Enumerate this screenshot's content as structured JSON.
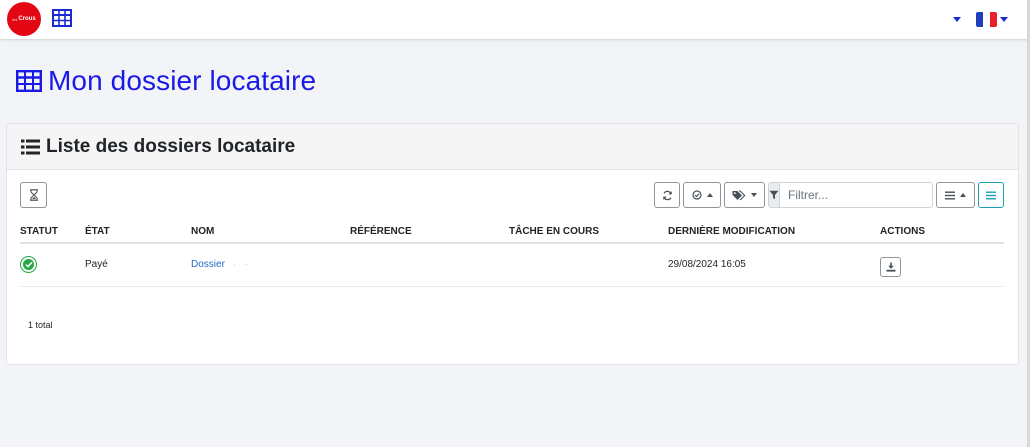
{
  "navbar": {
    "logo_small": "les",
    "logo_text": "Crous",
    "table_icon": "table-icon",
    "user_menu_caret": "caret-down-icon",
    "language_flag": "flag-fr-icon",
    "colors": {
      "accent": "#1a1ae6",
      "logo_bg": "#e30613"
    }
  },
  "page": {
    "title": "Mon dossier locataire",
    "title_icon": "table-icon"
  },
  "card": {
    "title": "Liste des dossiers locataire",
    "title_icon": "list-icon"
  },
  "toolbar": {
    "pending_icon": "hourglass-icon",
    "refresh_icon": "refresh-icon",
    "status_filter_icon": "check-circle-icon",
    "tags_icon": "tags-icon",
    "filter_icon": "filter-icon",
    "filter_placeholder": "Filtrer...",
    "columns_icon": "list-lines-icon",
    "view_icon": "lines-icon"
  },
  "table": {
    "headers": {
      "statut": "STATUT",
      "etat": "ÉTAT",
      "nom": "NOM",
      "reference": "RÉFÉRENCE",
      "tache": "TÂCHE EN COURS",
      "modification": "DERNIÈRE MODIFICATION",
      "actions": "ACTIONS"
    },
    "rows": [
      {
        "statut_icon": "check-circle-icon",
        "etat": "Payé",
        "nom": "Dossier",
        "nom_suffix": "· ·",
        "reference": "",
        "tache": "",
        "modification": "29/08/2024 16:05",
        "action_icon": "download-icon"
      }
    ]
  },
  "footer": {
    "total": "1 total"
  }
}
